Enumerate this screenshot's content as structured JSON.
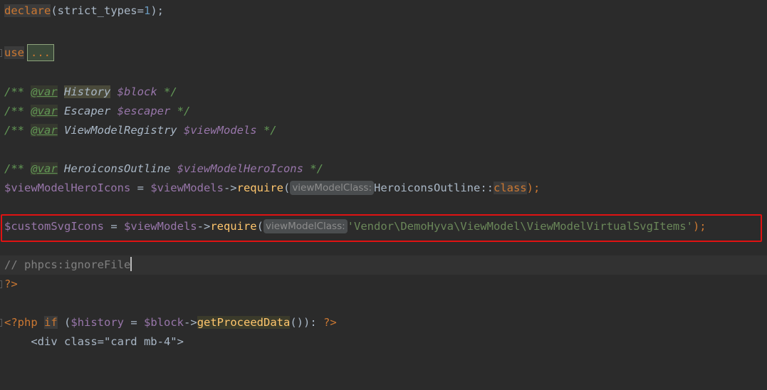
{
  "editor": {
    "lines": {
      "l1": {
        "kw": "declare",
        "rest1": "(strict_types=",
        "num": "1",
        "rest2": ");"
      },
      "l3": {
        "kw": "use",
        "fold": "..."
      },
      "l5": {
        "open": "/** ",
        "tag": "@var",
        "type": "History",
        "var": "$block",
        "close": " */"
      },
      "l6": {
        "open": "/** ",
        "tag": "@var",
        "type": "Escaper",
        "var": "$escaper",
        "close": " */"
      },
      "l7": {
        "open": "/** ",
        "tag": "@var",
        "type": "ViewModelRegistry",
        "var": "$viewModels",
        "close": " */"
      },
      "l9": {
        "open": "/** ",
        "tag": "@var",
        "type": "HeroiconsOutline",
        "var": "$viewModelHeroIcons",
        "close": " */"
      },
      "l10": {
        "lhs": "$viewModelHeroIcons",
        "eq": " = ",
        "obj": "$viewModels",
        "arrow": "->",
        "fn": "require",
        "paren": "(",
        "hint": "viewModelClass:",
        "cls": "HeroiconsOutline",
        "sep": "::",
        "kw": "class",
        "end": ");"
      },
      "l12": {
        "lhs": "$customSvgIcons",
        "eq": " = ",
        "obj": "$viewModels",
        "arrow": "->",
        "fn": "require",
        "paren": "(",
        "hint": "viewModelClass:",
        "str": "'Vendor\\DemoHyva\\ViewModel\\ViewModelVirtualSvgItems'",
        "end": ");"
      },
      "l14": {
        "comment": "// phpcs:ignoreFile"
      },
      "l15": {
        "close_tag": "?>"
      },
      "l17": {
        "open_tag": "<?php",
        "kw": "if",
        "p1": " (",
        "var1": "$history",
        "eq": " = ",
        "var2": "$block",
        "arrow": "->",
        "fn": "getProceedData",
        "p2": "()): ",
        "close_tag": "?>"
      },
      "l18": {
        "text": "    <div class=\"card mb-4\">"
      }
    }
  },
  "colors": {
    "background": "#2b2b2b",
    "keyword": "#cc7832",
    "variable": "#9876aa",
    "function": "#ffc66d",
    "string": "#6a8759",
    "doc_comment": "#629755",
    "highlight_box": "#e01212"
  }
}
